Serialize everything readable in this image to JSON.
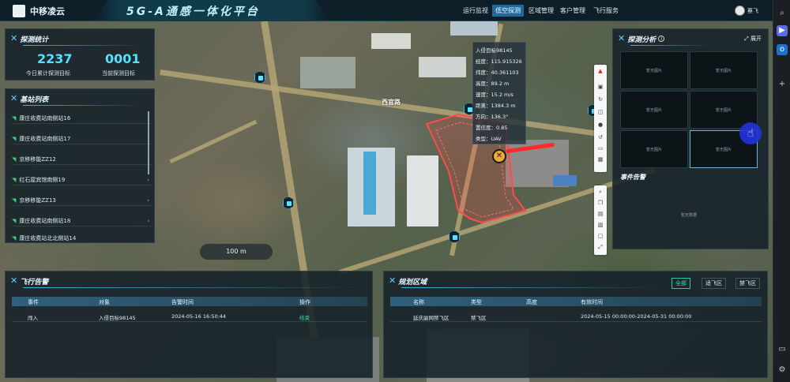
{
  "topbar": {
    "brand": "中移凌云",
    "title": "5G-A通感一体化平台",
    "nav": [
      "运行监视",
      "低空探测",
      "区域管理",
      "客户管理",
      "飞行服务"
    ],
    "active_nav": 1,
    "user": "蔡飞"
  },
  "detect_stats": {
    "title": "探测统计",
    "items": [
      {
        "value": "2237",
        "label": "今日累计探测目标"
      },
      {
        "value": "0001",
        "label": "当前探测目标"
      }
    ]
  },
  "stations": {
    "title": "基站列表",
    "items": [
      "康庄收费站南侧站16",
      "康庄收费站南侧站17",
      "京移移能ZZ12",
      "红石屋宾馆南侧19",
      "京移移能ZZ13",
      "康庄收费站南侧站18",
      "康庄收费站北北侧站14"
    ]
  },
  "map": {
    "road_label": "西官路",
    "scale": "100 m",
    "drone_popup": [
      "入侵目标98145",
      "经度：115.915326",
      "纬度：40.361103",
      "高度：89.2 m",
      "速度：15.2 m/s",
      "距离：1384.3 m",
      "方向：136.3°",
      "置信度：0.85",
      "类型：UAV"
    ],
    "accent_zone_color": "#ff4b4b"
  },
  "analysis": {
    "title": "探测分析",
    "expand": "展开",
    "cells": [
      "暂无图片",
      "暂无图片",
      "暂无图片",
      "暂无图片",
      "暂无图片",
      "暂无图片"
    ],
    "event_title": "事件告警",
    "event_empty": "暂无数据"
  },
  "flight_alarm": {
    "title": "飞行告警",
    "columns": [
      "事件",
      "对象",
      "告警时间",
      "操作"
    ],
    "rows": [
      {
        "event": "闯入",
        "object": "入侵目标98145",
        "time": "2024-05-16 16:50:44",
        "action": "结束"
      }
    ]
  },
  "planning": {
    "title": "规划区域",
    "tabs": [
      "全部",
      "适飞区",
      "禁飞区"
    ],
    "active_tab": 0,
    "columns": [
      "名称",
      "类型",
      "高度",
      "有效时间"
    ],
    "rows": [
      {
        "name": "延庆副网禁飞区",
        "type": "禁飞区",
        "height": "",
        "valid": "2024-05-15 00:00:00-2024-05-31 00:00:00"
      }
    ]
  }
}
